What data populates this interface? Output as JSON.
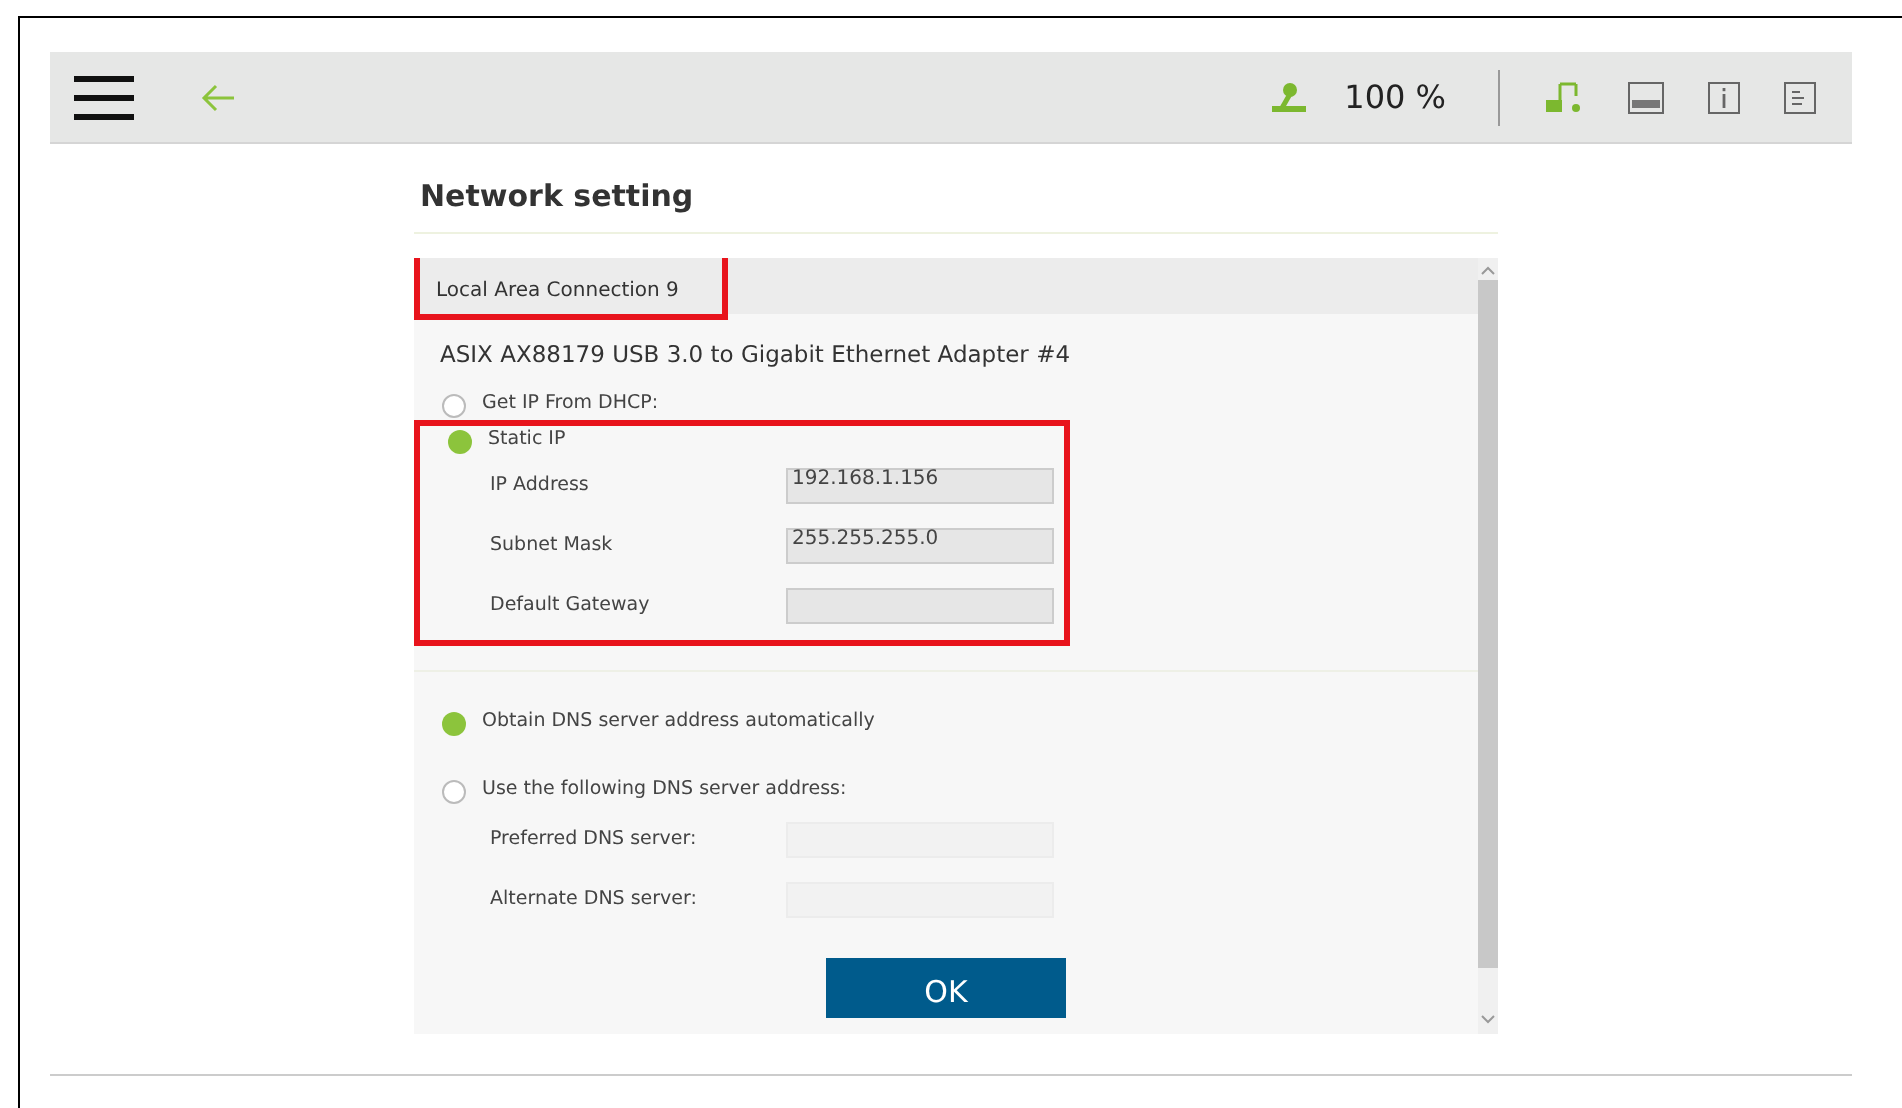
{
  "toolbar": {
    "zoom": "100 %"
  },
  "page_title": "Network setting",
  "connection": {
    "name": "Local Area Connection 9",
    "highlighted": true
  },
  "adapter": "ASIX AX88179 USB 3.0 to Gigabit Ethernet Adapter #4",
  "ip_options": [
    {
      "label": "Get IP From DHCP:",
      "selected": false
    },
    {
      "label": "Static IP",
      "selected": true
    }
  ],
  "static_highlighted": true,
  "static_fields": [
    {
      "label": "IP Address",
      "value": "192.168.1.156"
    },
    {
      "label": "Subnet Mask",
      "value": "255.255.255.0"
    },
    {
      "label": "Default Gateway"
    }
  ],
  "dns_options": [
    {
      "label": "Obtain DNS server address automatically",
      "selected": true
    },
    {
      "label": "Use the following DNS server address:",
      "selected": false
    }
  ],
  "dns_fields": [
    {
      "label": "Preferred DNS server:",
      "disabled": true
    },
    {
      "label": "Alternate DNS server:",
      "disabled": true
    }
  ],
  "ok_button": "OK"
}
